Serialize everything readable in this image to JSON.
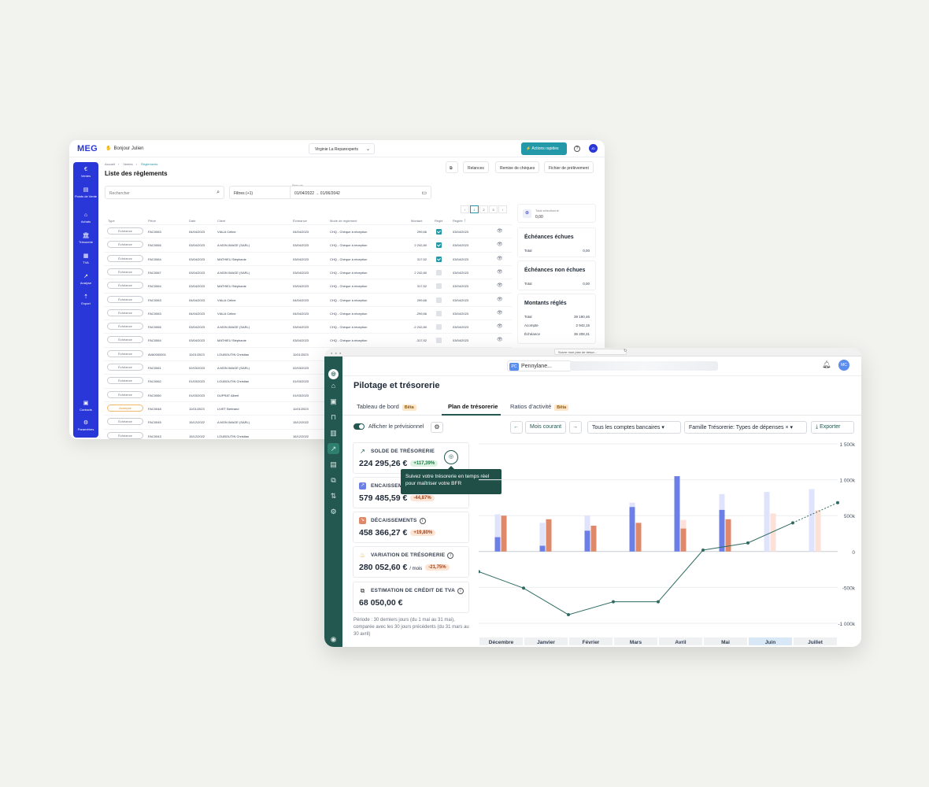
{
  "meg": {
    "logo": "MEG",
    "greeting": "Bonjour Julien",
    "company": "Virginie La Reparexperts",
    "quick_actions": "Actions rapides",
    "avatar": "JD",
    "breadcrumb": [
      "Accueil",
      "Ventes",
      "Règlements"
    ],
    "title": "Liste des règlements",
    "top_buttons": [
      "Relances",
      "Remise de chèques",
      "Fichier de prélèvement"
    ],
    "search_placeholder": "Rechercher",
    "filters": "Filtres (+1)",
    "period_label": "Période",
    "period_value": "01/04/2022 → 01/06/2042",
    "pager": [
      "‹",
      "1",
      "2",
      "3",
      "›"
    ],
    "sidebar": [
      "Ventes",
      "Points de Vente",
      "Achats",
      "Trésorerie",
      "TVA",
      "Analyse",
      "Export",
      "Contacts",
      "Paramètres"
    ],
    "columns": [
      "Type",
      "Pièce",
      "Date",
      "Client",
      "Échéance",
      "Mode de règlement",
      "Montant",
      "Réglé",
      "Réglée"
    ],
    "rows": [
      {
        "type": "Échéance",
        "piece": "FAC0063",
        "date": "04/04/2023",
        "client": "VIALA Céline",
        "echeance": "04/04/2023",
        "mode": "CHQ - Chèque à réception",
        "montant": "299,66",
        "regle": true,
        "reglee": "03/04/2023"
      },
      {
        "type": "Échéance",
        "piece": "FAC0065",
        "date": "03/04/2023",
        "client": "A MON IMAGE (SARL)",
        "echeance": "03/04/2023",
        "mode": "CHQ - Chèque à réception",
        "montant": "2 242,80",
        "regle": true,
        "reglee": "03/04/2023"
      },
      {
        "type": "Échéance",
        "piece": "FAC0064",
        "date": "03/04/2023",
        "client": "MATHIEU Stéphanie",
        "echeance": "03/04/2023",
        "mode": "CHQ - Chèque à réception",
        "montant": "317,52",
        "regle": true,
        "reglee": "03/04/2023"
      },
      {
        "type": "Échéance",
        "piece": "FAC0067",
        "date": "03/04/2023",
        "client": "A MON IMAGE (SARL)",
        "echeance": "03/04/2023",
        "mode": "CHQ - Chèque à réception",
        "montant": "2 242,80",
        "regle": false,
        "reglee": "03/04/2023"
      },
      {
        "type": "Échéance",
        "piece": "FAC0064",
        "date": "03/04/2023",
        "client": "MATHIEU Stéphanie",
        "echeance": "03/04/2023",
        "mode": "CHQ - Chèque à réception",
        "montant": "317,52",
        "regle": false,
        "reglee": "03/04/2023"
      },
      {
        "type": "Échéance",
        "piece": "FAC0063",
        "date": "04/04/2023",
        "client": "VIALA Céline",
        "echeance": "04/04/2023",
        "mode": "CHQ - Chèque à réception",
        "montant": "299,66",
        "regle": false,
        "reglee": "03/04/2023"
      },
      {
        "type": "Échéance",
        "piece": "FAC0063",
        "date": "04/04/2023",
        "client": "VIALA Céline",
        "echeance": "04/04/2023",
        "mode": "CHQ - Chèque à réception",
        "montant": "-299,66",
        "regle": false,
        "reglee": "03/04/2023"
      },
      {
        "type": "Échéance",
        "piece": "FAC0065",
        "date": "03/04/2023",
        "client": "A MON IMAGE (SARL)",
        "echeance": "03/04/2023",
        "mode": "CHQ - Chèque à réception",
        "montant": "-2 242,80",
        "regle": false,
        "reglee": "03/04/2023"
      },
      {
        "type": "Échéance",
        "piece": "FAC0064",
        "date": "03/04/2023",
        "client": "MATHIEU Stéphanie",
        "echeance": "03/04/2023",
        "mode": "CHQ - Chèque à réception",
        "montant": "-317,52",
        "regle": false,
        "reglee": "03/04/2023"
      },
      {
        "type": "Échéance",
        "piece": "AVA0000001",
        "date": "11/01/2023",
        "client": "LOUBOUTIN Christian",
        "echeance": "11/01/2023",
        "mode": "",
        "montant": "",
        "regle": null,
        "reglee": ""
      },
      {
        "type": "Échéance",
        "piece": "FAC0061",
        "date": "02/03/2023",
        "client": "A MON IMAGE (SARL)",
        "echeance": "02/03/2023",
        "mode": "",
        "montant": "",
        "regle": null,
        "reglee": ""
      },
      {
        "type": "Échéance",
        "piece": "FAC0062",
        "date": "01/03/2023",
        "client": "LOUBOUTIN Christian",
        "echeance": "01/03/2023",
        "mode": "",
        "montant": "",
        "regle": null,
        "reglee": ""
      },
      {
        "type": "Échéance",
        "piece": "FAC0060",
        "date": "01/03/2023",
        "client": "DUPRAT Albert",
        "echeance": "01/03/2023",
        "mode": "",
        "montant": "",
        "regle": null,
        "reglee": ""
      },
      {
        "type": "Acompte",
        "piece": "FAC0048",
        "date": "11/01/2023",
        "client": "LIVET Bertrand",
        "echeance": "11/01/2023",
        "mode": "",
        "montant": "",
        "regle": null,
        "reglee": ""
      },
      {
        "type": "Échéance",
        "piece": "FAC0045",
        "date": "15/12/2022",
        "client": "A MON IMAGE (SARL)",
        "echeance": "15/12/2022",
        "mode": "",
        "montant": "",
        "regle": null,
        "reglee": ""
      },
      {
        "type": "Échéance",
        "piece": "FAC0043",
        "date": "15/12/2022",
        "client": "LOUBOUTIN Christian",
        "echeance": "16/12/2022",
        "mode": "",
        "montant": "",
        "regle": null,
        "reglee": ""
      }
    ],
    "total_selected_label": "Total sélectionné",
    "total_selected_value": "0,00",
    "cards": [
      {
        "title": "Échéances échues",
        "lines": [
          {
            "label": "Total",
            "value": "0,00"
          }
        ]
      },
      {
        "title": "Échéances non échues",
        "lines": [
          {
            "label": "Total",
            "value": "0,00"
          }
        ]
      },
      {
        "title": "Montants réglés",
        "lines": [
          {
            "label": "Total",
            "value": "39 190,46"
          },
          {
            "label": "Acompte",
            "value": "2 942,15"
          },
          {
            "label": "Échéance",
            "value": "36 208,31"
          }
        ]
      }
    ]
  },
  "pl": {
    "tab_title": "Suivre mon plan de trésor...",
    "org_badge": "PC",
    "org_name": "Pennylane...",
    "avatar": "MC",
    "title": "Pilotage et trésorerie",
    "tabs": [
      {
        "label": "Tableau de bord",
        "beta": "Bêta"
      },
      {
        "label": "Plan de trésorerie",
        "beta": ""
      },
      {
        "label": "Ratios d'activité",
        "beta": "Bêta"
      }
    ],
    "toggle_label": "Afficher le prévisionnel",
    "period_button": "Mois courant",
    "accounts_select": "Tous les comptes bancaires",
    "family_select": "Famille Trésorerie: Types de dépenses",
    "export_button": "Exporter",
    "kpis": [
      {
        "label": "SOLDE DE TRÉSORERIE",
        "value": "224 295,26 €",
        "suffix": "",
        "badge": "+117,39%",
        "tone": "g"
      },
      {
        "label": "ENCAISSEMENTS",
        "value": "579 485,59 €",
        "suffix": "",
        "badge": "-44,87%",
        "tone": "o"
      },
      {
        "label": "DÉCAISSEMENTS",
        "value": "458 366,27 €",
        "suffix": "",
        "badge": "+19,80%",
        "tone": "o"
      },
      {
        "label": "VARIATION DE TRÉSORERIE",
        "value": "280 052,60 €",
        "suffix": "/ mois",
        "badge": "-21,75%",
        "tone": "o"
      },
      {
        "label": "ESTIMATION DE CRÉDIT DE TVA",
        "value": "68 050,00 €",
        "suffix": "",
        "badge": "",
        "tone": ""
      }
    ],
    "tooltip": "Suivez votre trésorerie en temps réel pour maîtriser votre BFR",
    "periode_note": "Période : 30 derniers jours (du 1 mai au 31 mai), comparée avec les 30 jours précédents (du 31 mars au 30 avril)"
  },
  "chart_data": {
    "type": "bar",
    "categories": [
      "Décembre",
      "Janvier",
      "Février",
      "Mars",
      "Avril",
      "Mai",
      "Juin",
      "Juillet"
    ],
    "highlight_category": "Juin",
    "y_tick_labels": [
      "1 500k",
      "1 000k",
      "500k",
      "0",
      "-500k",
      "-1 000k"
    ],
    "ylim": [
      -1000,
      1500
    ],
    "series": [
      {
        "role": "encaissements",
        "color": "#6b7fe6",
        "forecast_color": "#dfe3fb",
        "values": [
          200,
          80,
          290,
          620,
          1050,
          580,
          0,
          0
        ],
        "forecast": [
          520,
          400,
          500,
          680,
          760,
          800,
          830,
          870
        ]
      },
      {
        "role": "décaissements",
        "color": "#e0896a",
        "forecast_color": "#fbe1d7",
        "values": [
          500,
          450,
          360,
          400,
          320,
          450,
          0,
          0
        ],
        "forecast": [
          0,
          0,
          0,
          0,
          440,
          0,
          530,
          580
        ]
      }
    ],
    "line": {
      "color": "#2f6b61",
      "values": [
        -280,
        -510,
        -880,
        -700,
        -700,
        20,
        120,
        400,
        680
      ]
    }
  },
  "colors": {
    "meg_primary": "#2a37d8",
    "meg_teal": "#2398a8",
    "pl_sidebar": "#235851",
    "pl_accent": "#235851"
  }
}
